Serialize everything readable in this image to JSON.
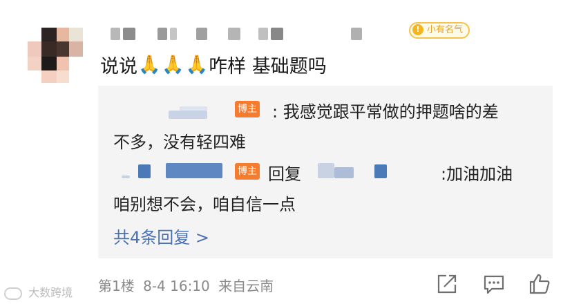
{
  "comment": {
    "badge_label": "小有名气",
    "badge_icon": "crown-icon",
    "text_before": "说说",
    "emoji": [
      "🙏",
      "🙏",
      "🙏"
    ],
    "text_after": "咋样 基础题吗"
  },
  "replies": [
    {
      "badge": "博主",
      "line1": ": 我感觉跟平常做的押题啥的差",
      "line2": "不多，没有轻四难"
    },
    {
      "badge": "博主",
      "reply_word": "回复",
      "line1_tail": ":加油加油",
      "line2": "咱别想不会，咱自信一点"
    }
  ],
  "more_replies": "共4条回复 >",
  "meta": {
    "floor": "第1楼",
    "date": "8-4 16:10",
    "source": "来自云南"
  },
  "actions": [
    "share-icon",
    "comment-icon",
    "like-icon"
  ],
  "watermark": "大数跨境",
  "colors": {
    "link": "#4a72b2",
    "bozhu_badge": "#f57b2e",
    "reply_bg": "#f4f4f4",
    "meta_text": "#8a8a8a"
  }
}
